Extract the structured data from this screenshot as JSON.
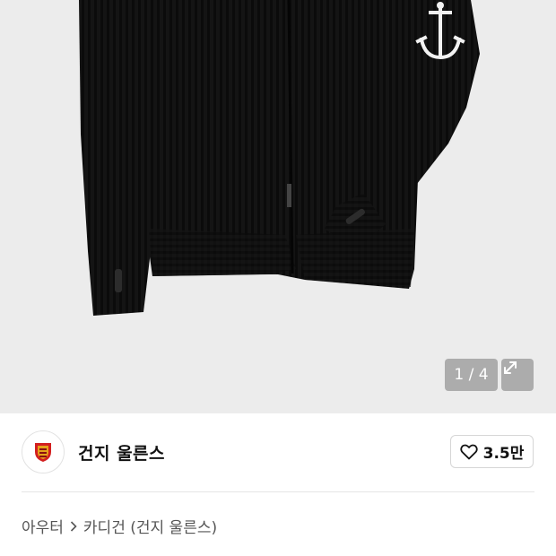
{
  "gallery": {
    "counter": "1 / 4",
    "expand_icon": "expand-arrows-icon",
    "background_color": "#ececec"
  },
  "brand": {
    "name": "건지 울른스",
    "logo_icon": "crest-logo-icon",
    "like_icon": "heart-outline-icon",
    "like_count": "3.5만"
  },
  "breadcrumb": {
    "items": [
      "아우터",
      "카디건 (건지 울른스)"
    ],
    "separator_icon": "chevron-right-icon"
  },
  "colors": {
    "sweater": "#111111",
    "anchor": "#f2f2f2",
    "overlay": "rgba(120,120,120,0.55)"
  }
}
